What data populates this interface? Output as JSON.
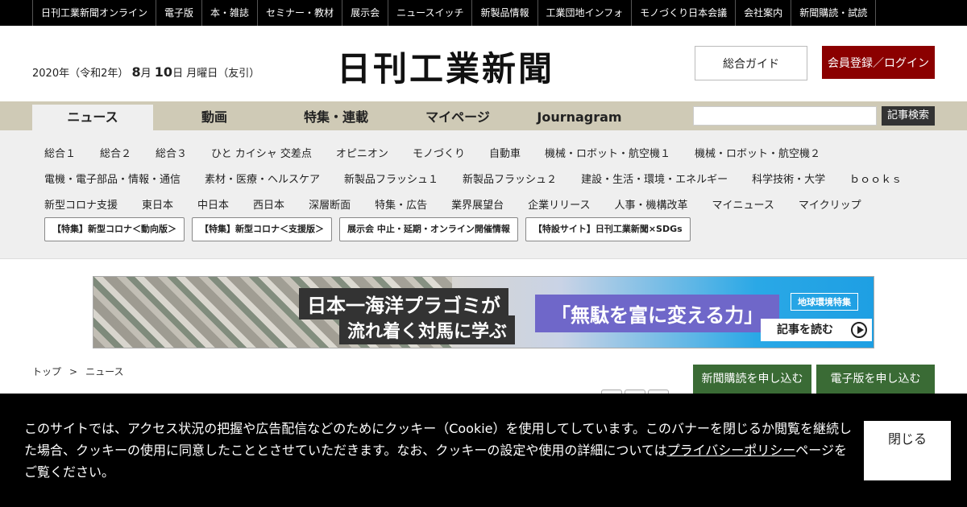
{
  "topbar": {
    "items": [
      "日刊工業新聞オンライン",
      "電子版",
      "本・雑誌",
      "セミナー・教材",
      "展示会",
      "ニュースイッチ",
      "新製品情報",
      "工業団地インフォ",
      "モノづくり日本会議",
      "会社案内",
      "新聞購読・試読"
    ]
  },
  "header": {
    "date_prefix": "2020年（令和2年）",
    "month": "8",
    "month_unit": "月",
    "day": "10",
    "day_suffix": "日 月曜日（友引）",
    "logo": "日刊工業新聞",
    "guide_label": "総合ガイド",
    "login_label": "会員登録／ログイン"
  },
  "nav": {
    "tabs": [
      "ニュース",
      "動画",
      "特集・連載",
      "マイページ",
      "Journagram"
    ],
    "active_tab": "ニュース",
    "search_placeholder": "",
    "search_button": "記事検索"
  },
  "subnav": {
    "row1": [
      "総合１",
      "総合２",
      "総合３",
      "ひと カイシャ 交差点",
      "オピニオン",
      "モノづくり",
      "自動車",
      "機械・ロボット・航空機１",
      "機械・ロボット・航空機２"
    ],
    "row2": [
      "電機・電子部品・情報・通信",
      "素材・医療・ヘルスケア",
      "新製品フラッシュ１",
      "新製品フラッシュ２",
      "建設・生活・環境・エネルギー",
      "科学技術・大学",
      "ｂｏｏｋｓ"
    ],
    "row3": [
      "新型コロナ支援",
      "東日本",
      "中日本",
      "西日本",
      "深層断面",
      "特集・広告",
      "業界展望台",
      "企業リリース",
      "人事・機構改革",
      "マイニュース",
      "マイクリップ"
    ],
    "specials": [
      "【特集】新型コロナ＜動向版＞",
      "【特集】新型コロナ＜支援版＞",
      "展示会 中止・延期・オンライン開催情報",
      "【特設サイト】日刊工業新聞×SDGs"
    ]
  },
  "banner": {
    "line1": "日本一海洋プラゴミが",
    "line2": "流れ着く対馬に学ぶ",
    "headline": "「無駄を富に変える力」",
    "tag": "地球環境特集",
    "read_more": "記事を読む"
  },
  "breadcrumb": {
    "home": "トップ",
    "separator": ">",
    "current": "ニュース"
  },
  "subscribe": {
    "paper": "新聞購読を申し込む",
    "digital": "電子版を申し込む"
  },
  "cookie": {
    "text_before": "このサイトでは、アクセス状況の把握や広告配信などのためにクッキー（Cookie）を使用してしています。このバナーを閉じるか閲覧を継続した場合、クッキーの使用に同意したこととさせていただきます。なお、クッキーの設定や使用の詳細については",
    "link": "プライバシーポリシー",
    "text_after": "ページをご覧ください。",
    "close_label": "閉じる"
  }
}
